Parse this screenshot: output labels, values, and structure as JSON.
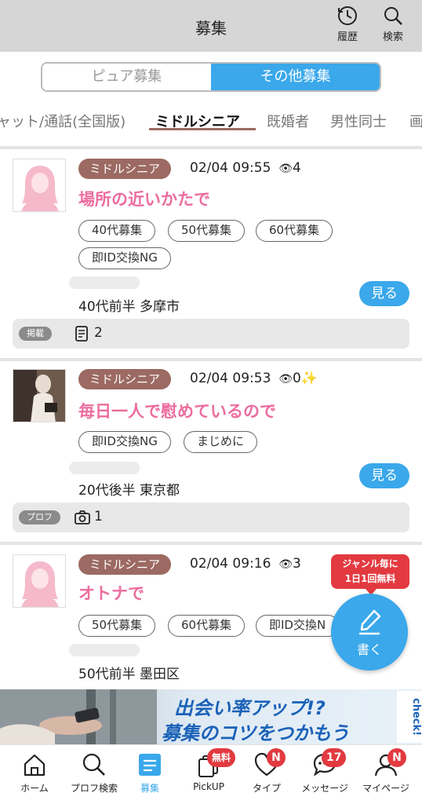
{
  "header": {
    "title": "募集",
    "history_label": "履歴",
    "search_label": "検索"
  },
  "segment": {
    "pure_label": "ピュア募集",
    "other_label": "その他募集",
    "selected": "その他募集"
  },
  "genres": [
    "ャット/通話(全国版)",
    "ミドルシニア",
    "既婚者",
    "男性同士",
    "画"
  ],
  "active_genre": "ミドルシニア",
  "posts": [
    {
      "genre": "ミドルシニア",
      "datetime": "02/04 09:55",
      "eye_icon": "eye-icon",
      "views": "4",
      "title": "場所の近いかたで",
      "tags": [
        "40代募集",
        "50代募集",
        "60代募集",
        "即ID交換NG"
      ],
      "profile": "40代前半 多摩市",
      "view_label": "見る",
      "bar_badge": "掲載",
      "bar_icon": "bulletin-icon",
      "bar_count": "2"
    },
    {
      "genre": "ミドルシニア",
      "datetime": "02/04 09:53",
      "eye_icon": "eye-icon",
      "views": "0",
      "sparkle": "✨",
      "title": "毎日一人で慰めているので",
      "tags": [
        "即ID交換NG",
        "まじめに"
      ],
      "profile": "20代後半 東京都",
      "view_label": "見る",
      "bar_badge": "プロフ",
      "bar_icon": "camera-icon",
      "bar_count": "1"
    },
    {
      "genre": "ミドルシニア",
      "datetime": "02/04 09:16",
      "eye_icon": "eye-icon",
      "views": "3",
      "title": "オトナで",
      "tags": [
        "50代募集",
        "60代募集",
        "即ID交換N"
      ],
      "profile": "50代前半 墨田区",
      "view_label": "見る"
    }
  ],
  "promo": {
    "line1": "ジャンル毎に",
    "line2": "1日1回無料"
  },
  "fab": {
    "label": "書く"
  },
  "ad": {
    "line1": "出会い率アップ!?",
    "line2": "募集のコツをつかもう",
    "check": "check!"
  },
  "tabs": [
    {
      "label": "ホーム",
      "icon": "home-icon"
    },
    {
      "label": "プロフ検索",
      "icon": "search-icon"
    },
    {
      "label": "募集",
      "icon": "board-icon"
    },
    {
      "label": "PickUP",
      "icon": "cards-icon",
      "badge": "無料"
    },
    {
      "label": "タイプ",
      "icon": "heart-icon",
      "badge": "N"
    },
    {
      "label": "メッセージ",
      "icon": "chat-icon",
      "badge": "17"
    },
    {
      "label": "マイページ",
      "icon": "user-icon",
      "badge": "N"
    }
  ],
  "active_tab": "募集",
  "colors": {
    "accent": "#3aa8ea",
    "genre_badge": "#9c6a62",
    "title_pink": "#ec6d9e",
    "badge_red": "#e23a40",
    "header_gray": "#d6d6d6"
  }
}
